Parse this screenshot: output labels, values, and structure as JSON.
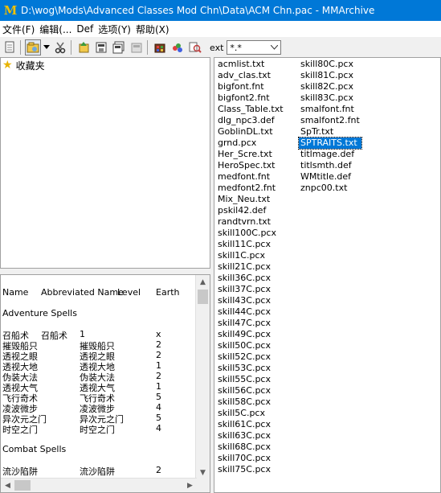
{
  "window": {
    "title": "D:\\wog\\Mods\\Advanced Classes Mod Chn\\Data\\ACM Chn.pac - MMArchive",
    "app_icon": "M"
  },
  "menu": [
    "文件(F)",
    "编辑(...",
    "Def",
    "选项(Y)",
    "帮助(X)"
  ],
  "toolbar": {
    "icons": [
      "new-file-icon",
      "open-folder-icon",
      "dropdown-arrow-icon",
      "scissors-icon",
      "add-file-icon",
      "extract-icon",
      "extract-all-icon",
      "delete-icon",
      "rebuild-icon",
      "palette-icon",
      "search-icon"
    ],
    "ext_label": "ext",
    "ext_value": "*.*"
  },
  "tree": {
    "favorites_label": "收藏夹"
  },
  "preview": {
    "header": {
      "name": "Name",
      "abbreviated": "Abbreviated Name",
      "level": "Level",
      "earth": "Earth"
    },
    "section1": "Adventure Spells",
    "adventure_rows": [
      {
        "name": "召船术",
        "abbr": "召船术",
        "level": "1",
        "earth": "x"
      },
      {
        "name": "摧毁船只",
        "abbr": "摧毁船只",
        "level": "2",
        "earth": "2"
      },
      {
        "name": "透视之眼",
        "abbr": "透视之眼",
        "level": "2",
        "earth": "2"
      },
      {
        "name": "透视大地",
        "abbr": "透视大地",
        "level": "1",
        "earth": "1"
      },
      {
        "name": "伪装大法",
        "abbr": "伪装大法",
        "level": "2",
        "earth": "2"
      },
      {
        "name": "透视大气",
        "abbr": "透视大气",
        "level": "1",
        "earth": "1"
      },
      {
        "name": "飞行奇术",
        "abbr": "飞行奇术",
        "level": "5",
        "earth": "5"
      },
      {
        "name": "凌波微步",
        "abbr": "凌波微步",
        "level": "4",
        "earth": "4"
      },
      {
        "name": "异次元之门",
        "abbr": "异次元之门",
        "level": "5",
        "earth": "5"
      },
      {
        "name": "时空之门",
        "abbr": "时空之门",
        "level": "4",
        "earth": "4"
      }
    ],
    "section2": "Combat Spells",
    "combat_rows": [
      {
        "name": "流沙陷阱",
        "abbr": "流沙陷阱",
        "level": "2",
        "earth": "2"
      }
    ]
  },
  "files": {
    "column1": [
      "acmlist.txt",
      "adv_clas.txt",
      "bigfont.fnt",
      "bigfont2.fnt",
      "Class_Table.txt",
      "dlg_npc3.def",
      "GoblinDL.txt",
      "grnd.pcx",
      "Her_Scre.txt",
      "HeroSpec.txt",
      "medfont.fnt",
      "medfont2.fnt",
      "Mix_Neu.txt",
      "pskil42.def",
      "randtvrn.txt",
      "skill100C.pcx",
      "skill11C.pcx",
      "skill1C.pcx",
      "skill21C.pcx",
      "skill36C.pcx",
      "skill37C.pcx",
      "skill43C.pcx",
      "skill44C.pcx",
      "skill47C.pcx",
      "skill49C.pcx",
      "skill50C.pcx",
      "skill52C.pcx",
      "skill53C.pcx",
      "skill55C.pcx",
      "skill56C.pcx",
      "skill58C.pcx",
      "skill5C.pcx",
      "skill61C.pcx",
      "skill63C.pcx",
      "skill68C.pcx",
      "skill70C.pcx",
      "skill75C.pcx"
    ],
    "column2": [
      "skill80C.pcx",
      "skill81C.pcx",
      "skill82C.pcx",
      "skill83C.pcx",
      "smalfont.fnt",
      "smalfont2.fnt",
      "SpTr.txt",
      "SPTRAITS.txt",
      "titlmage.def",
      "titlsmth.def",
      "WMtitle.def",
      "znpc00.txt"
    ],
    "selected": "SPTRAITS.txt"
  },
  "colors": {
    "titlebar": "#0078d7",
    "selection": "#0078d7",
    "star": "#e8b400"
  }
}
